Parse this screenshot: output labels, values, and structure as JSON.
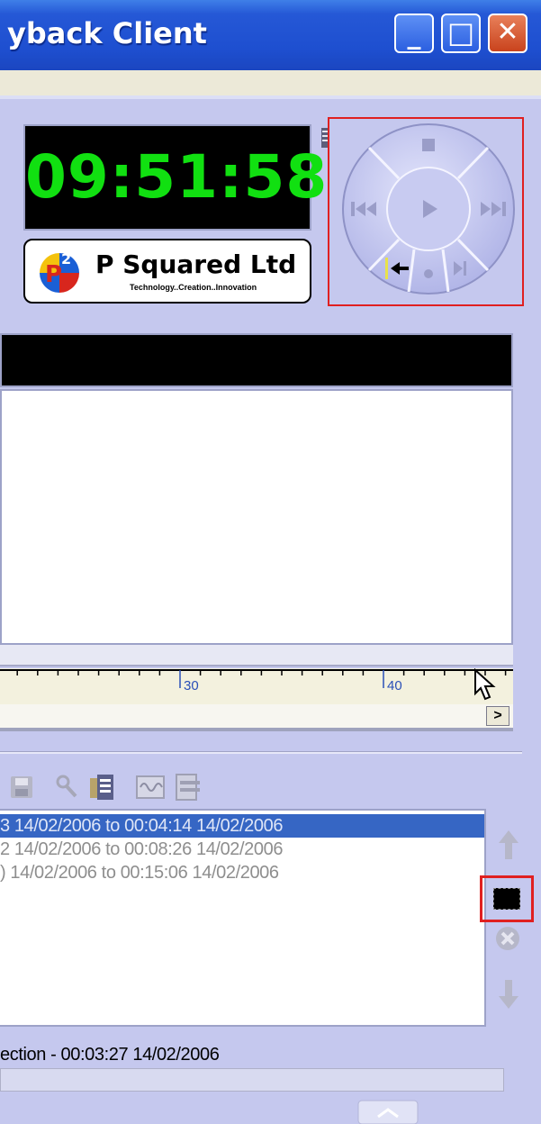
{
  "window": {
    "title": "yback Client",
    "controls": {
      "minimize": "_",
      "maximize": "□",
      "close": "✕"
    }
  },
  "clock": {
    "time": "09:51:58",
    "color": "#11e011"
  },
  "logo": {
    "name": "P Squared Ltd",
    "tagline": "Technology..Creation..Innovation",
    "icon": "p-squared-logo-icon"
  },
  "transport": {
    "buttons": [
      "stop-icon",
      "play-icon",
      "previous-icon",
      "next-icon",
      "cue-back-icon",
      "record-icon",
      "skip-end-icon"
    ]
  },
  "timeline": {
    "tick_labels": [
      "30",
      "40"
    ]
  },
  "toolbar": {
    "icons": [
      "save-icon",
      "search-icon",
      "clipboard-icon",
      "waveform-icon",
      "document-icon"
    ]
  },
  "list": {
    "rows": [
      {
        "text": "3 14/02/2006 to 00:04:14 14/02/2006",
        "selected": true
      },
      {
        "text": "2 14/02/2006 to 00:08:26 14/02/2006",
        "selected": false
      },
      {
        "text": ") 14/02/2006 to 00:15:06 14/02/2006",
        "selected": false
      }
    ]
  },
  "side_controls": [
    "move-up-icon",
    "stop-icon",
    "delete-icon",
    "move-down-icon"
  ],
  "status": {
    "text": "ection - 00:03:27 14/02/2006"
  },
  "colors": {
    "titlebar": "#2558d6",
    "panel": "#c5c8ee",
    "selection": "#3666c4",
    "highlight_frame": "#e02020"
  }
}
